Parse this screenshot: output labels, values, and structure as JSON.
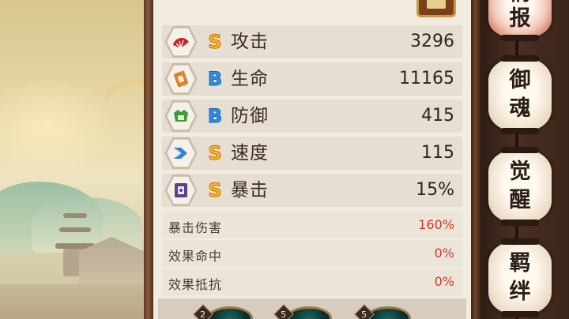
{
  "stats": [
    {
      "grade": "S",
      "name": "攻击",
      "value": "3296",
      "icon": "fan-icon",
      "icon_color": "#c0262c"
    },
    {
      "grade": "B",
      "name": "生命",
      "value": "11165",
      "icon": "talisman-icon",
      "icon_color": "#e0832a"
    },
    {
      "grade": "B",
      "name": "防御",
      "value": "415",
      "icon": "armor-icon",
      "icon_color": "#3f9a3b"
    },
    {
      "grade": "S",
      "name": "速度",
      "value": "115",
      "icon": "speed-icon",
      "icon_color": "#3a7fd0"
    },
    {
      "grade": "S",
      "name": "暴击",
      "value": "15%",
      "icon": "crit-icon",
      "icon_color": "#5b3f8e"
    }
  ],
  "sub_stats": [
    {
      "label": "暴击伤害",
      "value": "160%"
    },
    {
      "label": "效果命中",
      "value": "0%"
    },
    {
      "label": "效果抵抗",
      "value": "0%"
    }
  ],
  "side_tabs": [
    {
      "label_top": "情",
      "label_bottom": "报"
    },
    {
      "label_top": "御",
      "label_bottom": "魂"
    },
    {
      "label_top": "觉",
      "label_bottom": "醒"
    },
    {
      "label_top": "羁",
      "label_bottom": "绊"
    }
  ],
  "souls": [
    {
      "level": "2"
    },
    {
      "level": "5"
    },
    {
      "level": "5"
    }
  ],
  "colors": {
    "grade_s": "#f2b71c",
    "grade_b": "#2f8fe6",
    "sub_value": "#cf3a2c"
  }
}
